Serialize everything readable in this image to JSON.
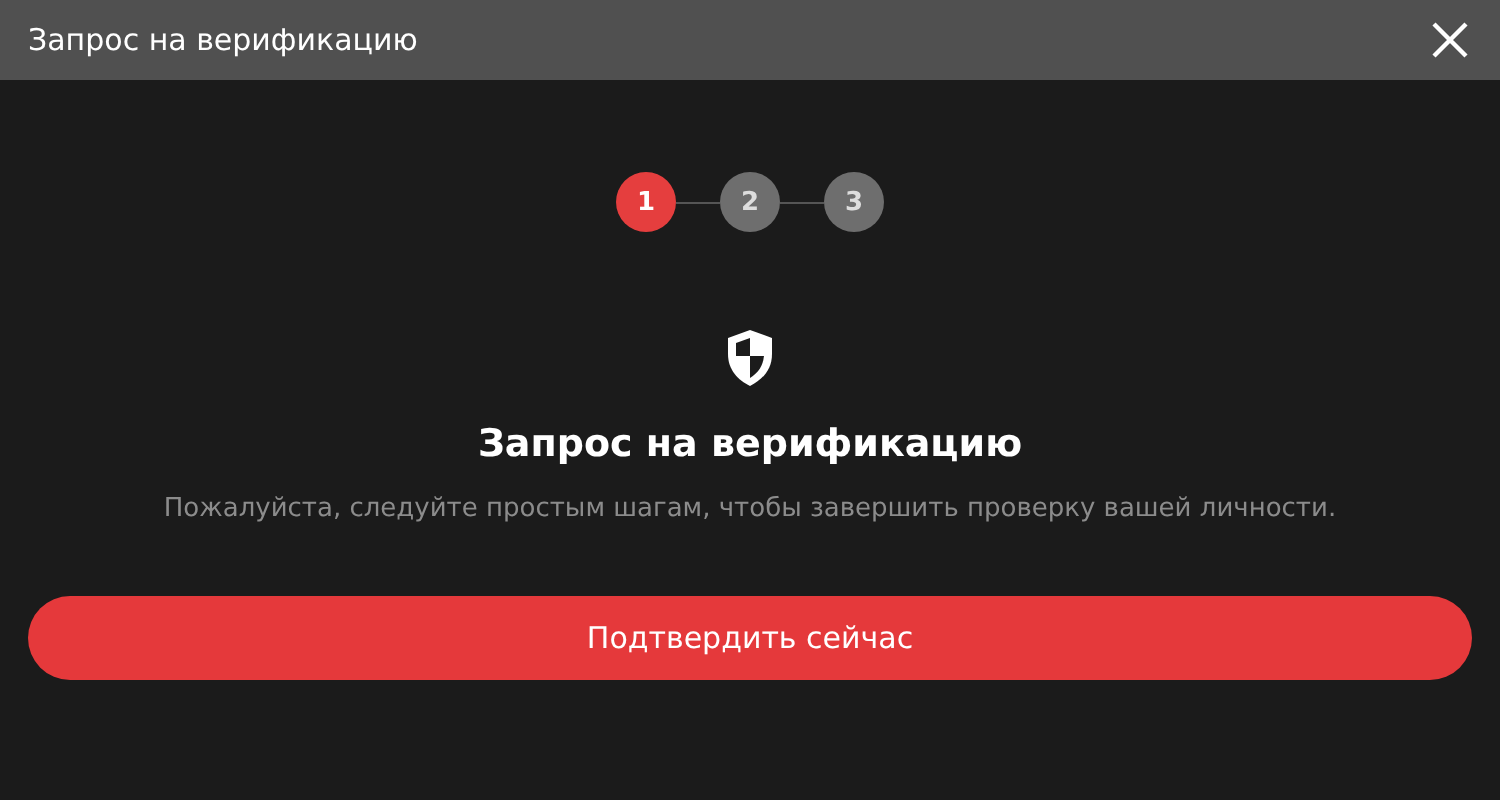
{
  "window": {
    "title": "Запрос на верификацию"
  },
  "steps": [
    {
      "label": "1",
      "selected": true
    },
    {
      "label": "2",
      "selected": false
    },
    {
      "label": "3",
      "selected": false
    }
  ],
  "heading": "Запрос на верификацию",
  "description": "Пожалуйста, следуйте простым шагам, чтобы завершить проверку вашей личности.",
  "button": "Подтвердить сейчас"
}
